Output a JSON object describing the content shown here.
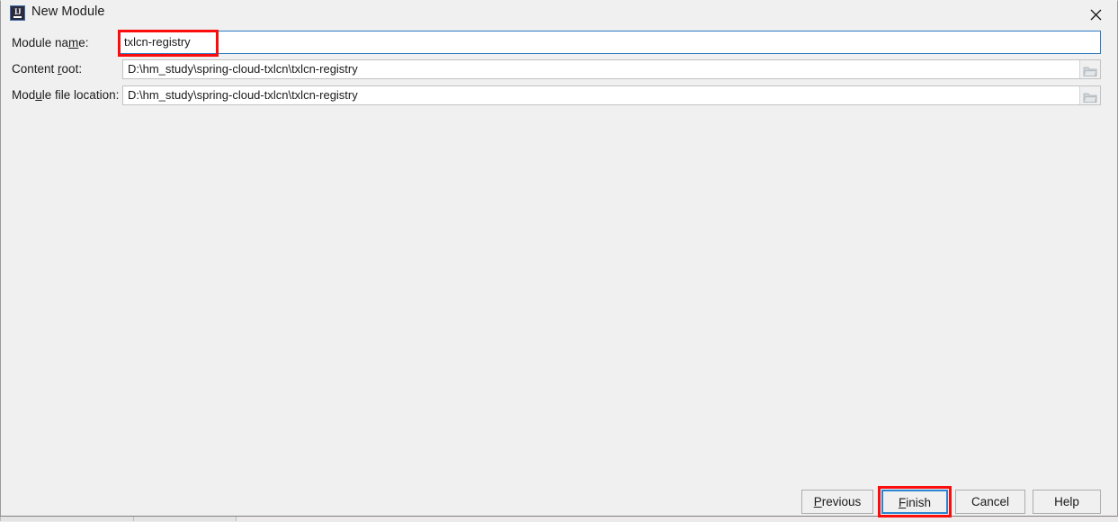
{
  "window": {
    "title": "New Module",
    "app_icon": "intellij-idea-icon",
    "close_icon": "close-icon"
  },
  "form": {
    "rows": [
      {
        "label_pre": "Module na",
        "label_mnemonic": "m",
        "label_post": "e:",
        "value": "txlcn-registry",
        "focused": true,
        "has_browse": false,
        "field_name": "module-name-field"
      },
      {
        "label_pre": "Content ",
        "label_mnemonic": "r",
        "label_post": "oot:",
        "value": "D:\\hm_study\\spring-cloud-txlcn\\txlcn-registry",
        "focused": false,
        "has_browse": true,
        "field_name": "content-root-field"
      },
      {
        "label_pre": "Mod",
        "label_mnemonic": "u",
        "label_post": "le file location:",
        "value": "D:\\hm_study\\spring-cloud-txlcn\\txlcn-registry",
        "focused": false,
        "has_browse": true,
        "field_name": "module-file-location-field"
      }
    ],
    "browse_icon": "folder-icon"
  },
  "buttons": [
    {
      "pre": "",
      "mnemonic": "P",
      "post": "revious",
      "name": "previous-button",
      "default": false
    },
    {
      "pre": "",
      "mnemonic": "F",
      "post": "inish",
      "name": "finish-button",
      "default": true
    },
    {
      "pre": "Cancel",
      "mnemonic": "",
      "post": "",
      "name": "cancel-button",
      "default": false
    },
    {
      "pre": "Help",
      "mnemonic": "",
      "post": "",
      "name": "help-button",
      "default": false
    }
  ],
  "annotations": [
    {
      "target": "module-name-field",
      "color": "#fb0d0d"
    },
    {
      "target": "finish-button",
      "color": "#fb0d0d"
    }
  ],
  "colors": {
    "dialog_bg": "#f0f0f0",
    "field_bg": "#ffffff",
    "focus_border": "#2a79c0",
    "default_button_border": "#2a84d2",
    "annotation": "#fb0d0d",
    "text": "#1b1b1b"
  }
}
